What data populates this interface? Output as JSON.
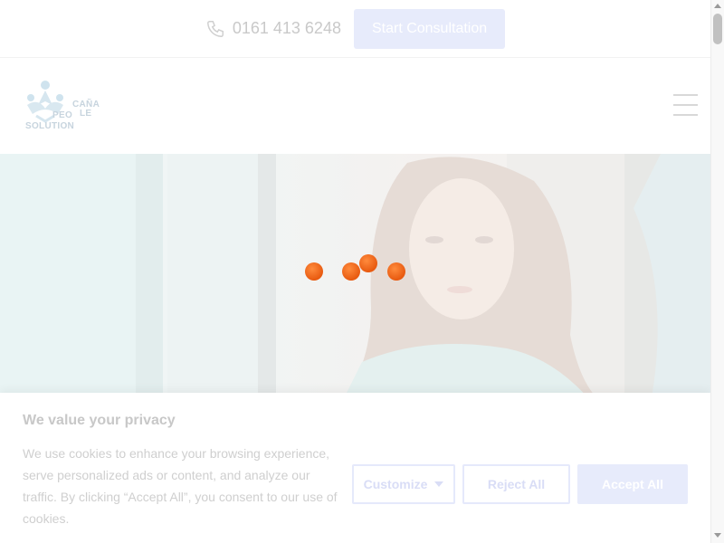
{
  "topbar": {
    "phone_icon": "phone-icon",
    "phone_number": "0161 413 6248",
    "consult_label": "Start Consultation"
  },
  "header": {
    "logo_lines": [
      "CAÑA",
      "PEO",
      "LE",
      "SOLUTION"
    ],
    "menu_icon": "hamburger-menu-icon"
  },
  "hero": {
    "loader_icon": "loading-dots-icon",
    "loader_color": "#ef6b1c"
  },
  "cookie": {
    "title": "We value your privacy",
    "body": "We use cookies to enhance your browsing experience, serve personalized ads or content, and analyze our traffic. By clicking “Accept All”, you consent to our use of cookies.",
    "customize_label": "Customize",
    "reject_label": "Reject All",
    "accept_label": "Accept All"
  }
}
